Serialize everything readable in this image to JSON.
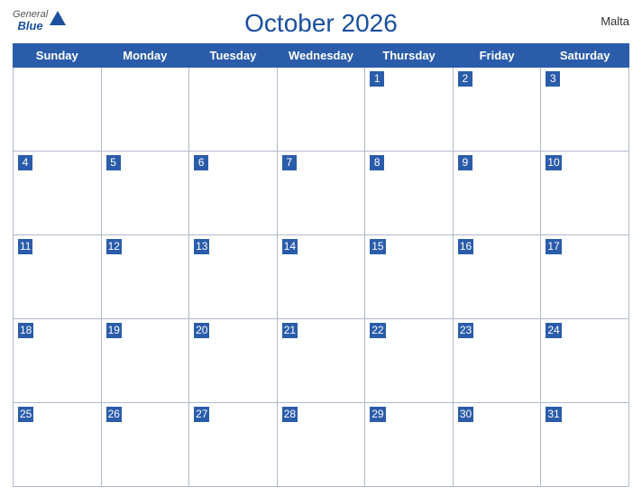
{
  "header": {
    "title": "October 2026",
    "country": "Malta",
    "logo_general": "General",
    "logo_blue": "Blue"
  },
  "days_of_week": [
    "Sunday",
    "Monday",
    "Tuesday",
    "Wednesday",
    "Thursday",
    "Friday",
    "Saturday"
  ],
  "weeks": [
    [
      null,
      null,
      null,
      null,
      1,
      2,
      3
    ],
    [
      4,
      5,
      6,
      7,
      8,
      9,
      10
    ],
    [
      11,
      12,
      13,
      14,
      15,
      16,
      17
    ],
    [
      18,
      19,
      20,
      21,
      22,
      23,
      24
    ],
    [
      25,
      26,
      27,
      28,
      29,
      30,
      31
    ]
  ]
}
